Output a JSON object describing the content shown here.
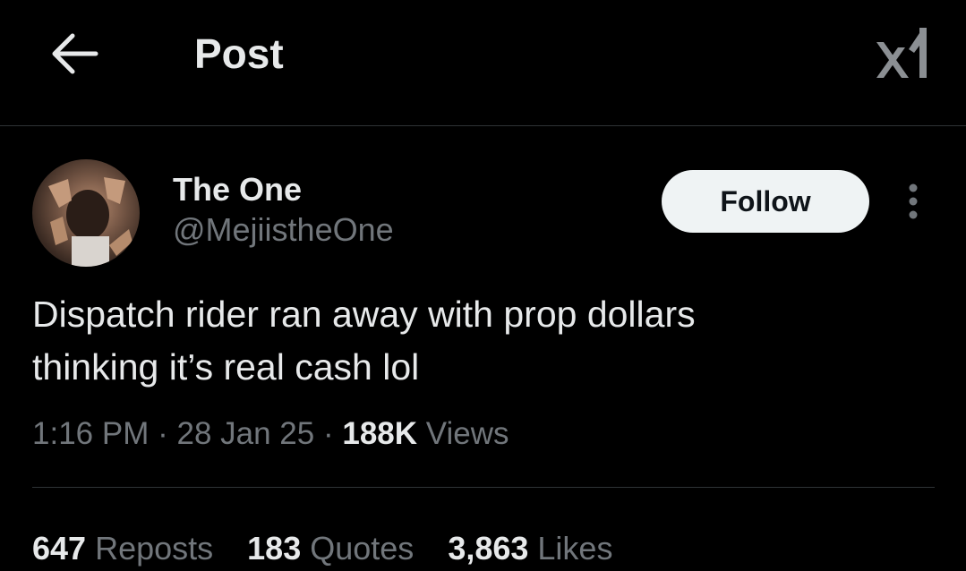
{
  "header": {
    "title": "Post",
    "back_icon": "arrow-left-icon",
    "logo_icon": "xai-logo-icon"
  },
  "author": {
    "display_name": "The One",
    "handle": "@MejiistheOne",
    "avatar": "user-avatar"
  },
  "actions": {
    "follow_label": "Follow",
    "more_icon": "more-vertical-icon"
  },
  "tweet": {
    "text_line1": "Dispatch rider ran away with prop dollars",
    "text_line2": "thinking it’s real cash lol"
  },
  "meta": {
    "time": "1:16 PM",
    "sep1": "·",
    "date": "28 Jan 25",
    "sep2": "·",
    "views_count": "188K",
    "views_label": "Views"
  },
  "stats": {
    "reposts_count": "647",
    "reposts_label": "Reposts",
    "quotes_count": "183",
    "quotes_label": "Quotes",
    "likes_count": "3,863",
    "likes_label": "Likes"
  },
  "colors": {
    "background": "#000000",
    "primary_text": "#e7e9ea",
    "secondary_text": "#71767b",
    "divider": "#2f3336",
    "follow_bg": "#eff3f4"
  }
}
